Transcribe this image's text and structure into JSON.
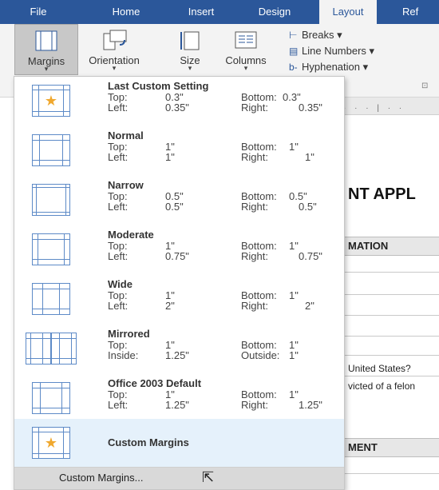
{
  "tabs": [
    {
      "label": "File",
      "active": false
    },
    {
      "label": "Home",
      "active": false
    },
    {
      "label": "Insert",
      "active": false
    },
    {
      "label": "Design",
      "active": false
    },
    {
      "label": "Layout",
      "active": true
    },
    {
      "label": "Ref",
      "active": false
    }
  ],
  "ribbon": {
    "margins_label": "Margins",
    "orientation_label": "Orientation",
    "size_label": "Size",
    "columns_label": "Columns",
    "caret": "▾",
    "breaks_label": "Breaks ▾",
    "line_numbers_label": "Line Numbers ▾",
    "hyphenation_label": "Hyphenation ▾",
    "dialog_launcher": "⊡"
  },
  "margin_presets": [
    {
      "name": "Last Custom Setting",
      "k1": "Top:",
      "v1": "0.3\"",
      "k2": "Bottom:",
      "v2": "0.3\"",
      "k3": "Left:",
      "v3": "0.35\"",
      "k4": "Right:",
      "v4": "0.35\"",
      "icon": "star-icon",
      "selected": false
    },
    {
      "name": "Normal",
      "k1": "Top:",
      "v1": "1\"",
      "k2": "Bottom:",
      "v2": "1\"",
      "k3": "Left:",
      "v3": "1\"",
      "k4": "Right:",
      "v4": "1\"",
      "icon": "page-icon",
      "selected": false
    },
    {
      "name": "Narrow",
      "k1": "Top:",
      "v1": "0.5\"",
      "k2": "Bottom:",
      "v2": "0.5\"",
      "k3": "Left:",
      "v3": "0.5\"",
      "k4": "Right:",
      "v4": "0.5\"",
      "icon": "page-icon",
      "selected": false
    },
    {
      "name": "Moderate",
      "k1": "Top:",
      "v1": "1\"",
      "k2": "Bottom:",
      "v2": "1\"",
      "k3": "Left:",
      "v3": "0.75\"",
      "k4": "Right:",
      "v4": "0.75\"",
      "icon": "page-icon",
      "selected": false
    },
    {
      "name": "Wide",
      "k1": "Top:",
      "v1": "1\"",
      "k2": "Bottom:",
      "v2": "1\"",
      "k3": "Left:",
      "v3": "2\"",
      "k4": "Right:",
      "v4": "2\"",
      "icon": "page-icon",
      "selected": false
    },
    {
      "name": "Mirrored",
      "k1": "Top:",
      "v1": "1\"",
      "k2": "Bottom:",
      "v2": "1\"",
      "k3": "Inside:",
      "v3": "1.25\"",
      "k4": "Outside:",
      "v4": "1\"",
      "icon": "page-icon",
      "selected": false
    },
    {
      "name": "Office 2003 Default",
      "k1": "Top:",
      "v1": "1\"",
      "k2": "Bottom:",
      "v2": "1\"",
      "k3": "Left:",
      "v3": "1.25\"",
      "k4": "Right:",
      "v4": "1.25\"",
      "icon": "page-icon",
      "selected": false
    },
    {
      "name": "Custom Margins",
      "icon": "star-icon",
      "selected": true
    }
  ],
  "custom_margins_command": "Custom Margins...",
  "document": {
    "title_fragment": "NT APPL",
    "section1": "MATION",
    "q1": "United States?",
    "q2": "victed of a felon",
    "section2": "MENT"
  },
  "colors": {
    "accent": "#2b579a",
    "star": "#f0a82e",
    "selected": "#e5f1fb"
  }
}
